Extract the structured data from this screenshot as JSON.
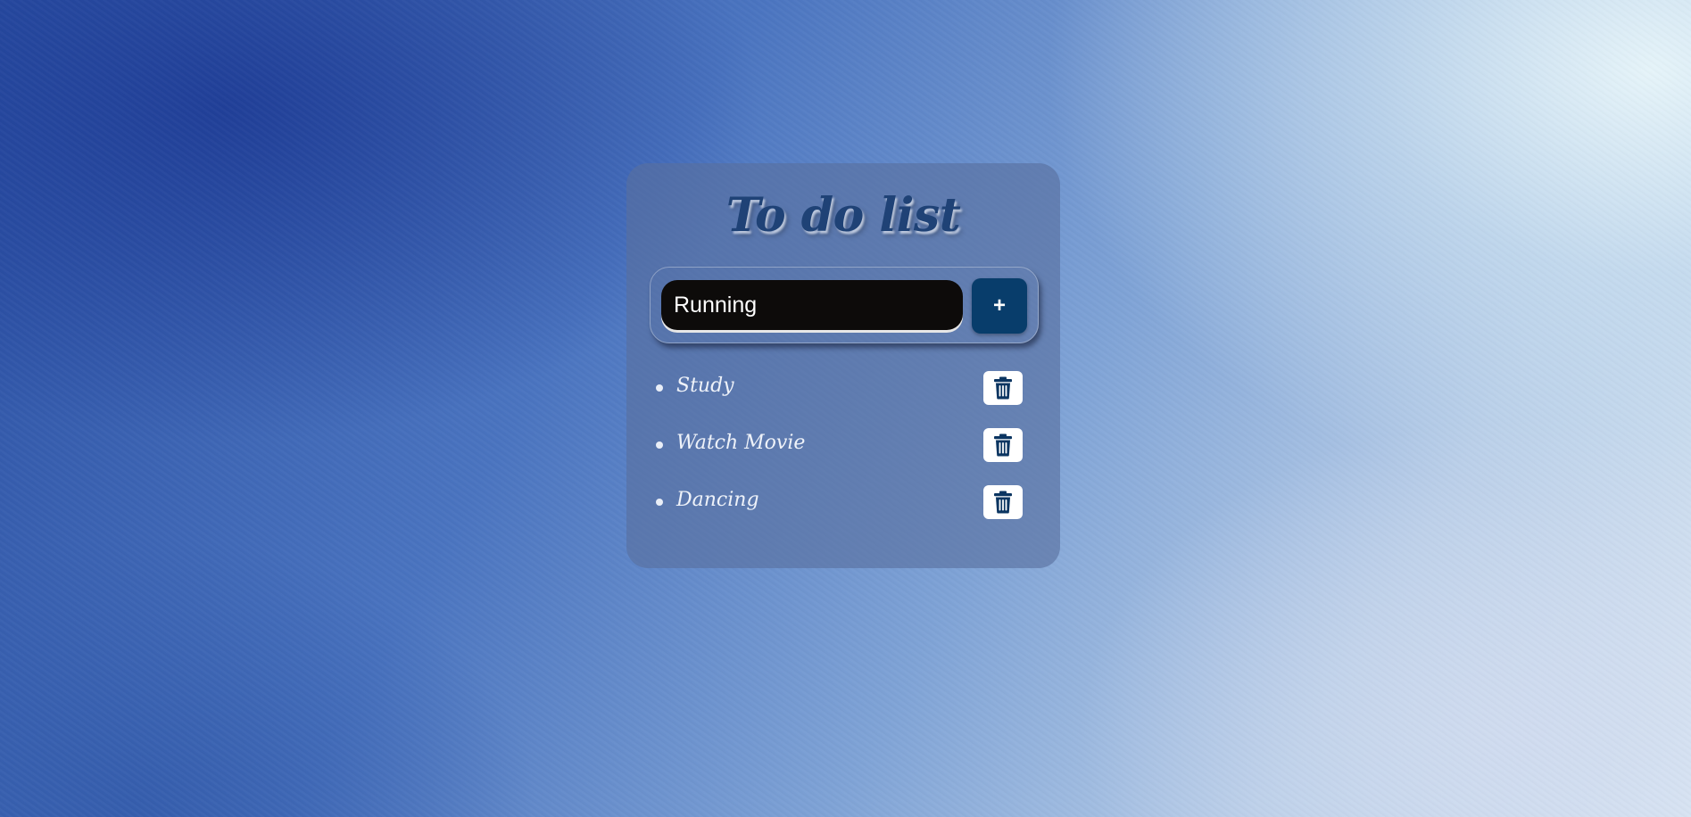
{
  "app": {
    "title": "To do list"
  },
  "input": {
    "value": "Running",
    "add_label": "+"
  },
  "tasks": [
    {
      "label": "Study",
      "delete_icon": "trash-icon"
    },
    {
      "label": "Watch Movie",
      "delete_icon": "trash-icon"
    },
    {
      "label": "Dancing",
      "delete_icon": "trash-icon"
    }
  ],
  "colors": {
    "accent": "#083d6b",
    "title": "#1f4276",
    "input_bg": "#0d0b0a",
    "card_bg": "#58709e"
  }
}
